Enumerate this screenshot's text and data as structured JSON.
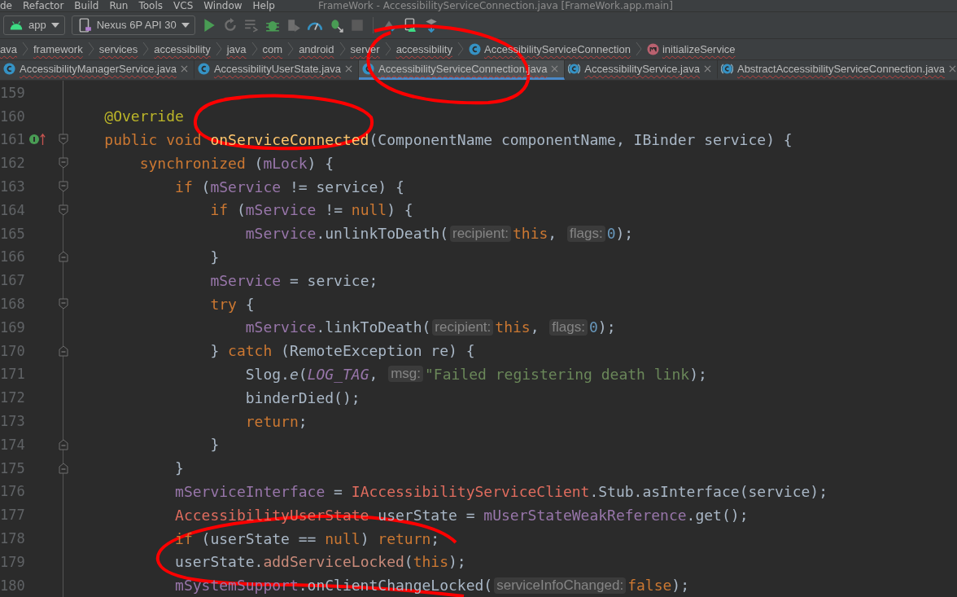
{
  "menu": {
    "items": [
      "de",
      "Refactor",
      "Build",
      "Run",
      "Tools",
      "VCS",
      "Window",
      "Help"
    ],
    "title": "FrameWork - AccessibilityServiceConnection.java [FrameWork.app.main]"
  },
  "toolbar": {
    "config": "app",
    "device": "Nexus 6P API 30"
  },
  "breadcrumbs": [
    {
      "label": "ava",
      "kind": "folder"
    },
    {
      "label": "framework",
      "kind": "folder"
    },
    {
      "label": "services",
      "kind": "folder"
    },
    {
      "label": "accessibility",
      "kind": "folder"
    },
    {
      "label": "java",
      "kind": "folder"
    },
    {
      "label": "com",
      "kind": "folder"
    },
    {
      "label": "android",
      "kind": "folder"
    },
    {
      "label": "server",
      "kind": "folder"
    },
    {
      "label": "accessibility",
      "kind": "folder"
    },
    {
      "label": "AccessibilityServiceConnection",
      "kind": "class"
    },
    {
      "label": "initializeService",
      "kind": "method"
    }
  ],
  "tabs": [
    {
      "label": "AccessibilityManagerService.java",
      "kind": "class",
      "selected": false
    },
    {
      "label": "AccessibilityUserState.java",
      "kind": "class",
      "selected": false
    },
    {
      "label": "AccessibilityServiceConnection.java",
      "kind": "class",
      "selected": true
    },
    {
      "label": "AccessibilityService.java",
      "kind": "abstract",
      "selected": false
    },
    {
      "label": "AbstractAccessibilityServiceConnection.java",
      "kind": "abstract",
      "selected": false
    }
  ],
  "code": [
    {
      "number": "159",
      "kind": "plain",
      "implements": false
    },
    {
      "number": "160",
      "kind": "plain",
      "implements": false,
      "tokens": [
        {
          "text": "    @Override",
          "kind": "annotation"
        }
      ]
    },
    {
      "number": "161",
      "kind": "fold-start",
      "implements": true,
      "tokens": [
        {
          "text": "    public void ",
          "kind": "keyword"
        },
        {
          "text": "onServiceConnected",
          "kind": "declaration"
        },
        {
          "text": "(ComponentName componentName, IBinder service) {",
          "kind": "plain"
        }
      ]
    },
    {
      "number": "162",
      "kind": "fold-start",
      "implements": false,
      "tokens": [
        {
          "text": "        synchronized ",
          "kind": "keyword"
        },
        {
          "text": "(",
          "kind": "plain"
        },
        {
          "text": "mLock",
          "kind": "field"
        },
        {
          "text": ") {",
          "kind": "plain"
        }
      ]
    },
    {
      "number": "163",
      "kind": "fold-start",
      "implements": false,
      "tokens": [
        {
          "text": "            if ",
          "kind": "keyword"
        },
        {
          "text": "(",
          "kind": "plain"
        },
        {
          "text": "mService",
          "kind": "field"
        },
        {
          "text": " != service) {",
          "kind": "plain"
        }
      ]
    },
    {
      "number": "164",
      "kind": "fold-start",
      "implements": false,
      "tokens": [
        {
          "text": "                if ",
          "kind": "keyword"
        },
        {
          "text": "(",
          "kind": "plain"
        },
        {
          "text": "mService",
          "kind": "field"
        },
        {
          "text": " != ",
          "kind": "plain"
        },
        {
          "text": "null",
          "kind": "keyword"
        },
        {
          "text": ") {",
          "kind": "plain"
        }
      ]
    },
    {
      "number": "165",
      "kind": "plain",
      "implements": false,
      "tokens": [
        {
          "text": "                    mService",
          "kind": "field"
        },
        {
          "text": ".unlinkToDeath(",
          "kind": "plain"
        },
        {
          "text": "recipient:",
          "kind": "hint"
        },
        {
          "text": "this",
          "kind": "keyword"
        },
        {
          "text": ", ",
          "kind": "plain"
        },
        {
          "text": "flags:",
          "kind": "hint"
        },
        {
          "text": "0",
          "kind": "number"
        },
        {
          "text": ");",
          "kind": "plain"
        }
      ]
    },
    {
      "number": "166",
      "kind": "fold-end",
      "implements": false,
      "tokens": [
        {
          "text": "                }",
          "kind": "plain"
        }
      ]
    },
    {
      "number": "167",
      "kind": "plain",
      "implements": false,
      "tokens": [
        {
          "text": "                mService",
          "kind": "field"
        },
        {
          "text": " = service;",
          "kind": "plain"
        }
      ]
    },
    {
      "number": "168",
      "kind": "fold-start",
      "implements": false,
      "tokens": [
        {
          "text": "                try",
          "kind": "keyword"
        },
        {
          "text": " {",
          "kind": "plain"
        }
      ]
    },
    {
      "number": "169",
      "kind": "plain",
      "implements": false,
      "tokens": [
        {
          "text": "                    mService",
          "kind": "field"
        },
        {
          "text": ".linkToDeath(",
          "kind": "plain"
        },
        {
          "text": "recipient:",
          "kind": "hint"
        },
        {
          "text": "this",
          "kind": "keyword"
        },
        {
          "text": ", ",
          "kind": "plain"
        },
        {
          "text": "flags:",
          "kind": "hint"
        },
        {
          "text": "0",
          "kind": "number"
        },
        {
          "text": ");",
          "kind": "plain"
        }
      ]
    },
    {
      "number": "170",
      "kind": "fold-end",
      "implements": false,
      "tokens": [
        {
          "text": "                } ",
          "kind": "plain"
        },
        {
          "text": "catch",
          "kind": "keyword"
        },
        {
          "text": " (RemoteException re) {",
          "kind": "plain"
        }
      ]
    },
    {
      "number": "171",
      "kind": "plain",
      "implements": false,
      "tokens": [
        {
          "text": "                    Slog.",
          "kind": "plain"
        },
        {
          "text": "e",
          "kind": "static"
        },
        {
          "text": "(",
          "kind": "plain"
        },
        {
          "text": "LOG_TAG",
          "kind": "constant"
        },
        {
          "text": ", ",
          "kind": "plain"
        },
        {
          "text": "msg:",
          "kind": "hint"
        },
        {
          "text": "\"Failed registering death link",
          "kind": "string"
        },
        {
          "text": ");",
          "kind": "plain"
        }
      ]
    },
    {
      "number": "172",
      "kind": "plain",
      "implements": false,
      "tokens": [
        {
          "text": "                    binderDied();",
          "kind": "plain"
        }
      ]
    },
    {
      "number": "173",
      "kind": "plain",
      "implements": false,
      "tokens": [
        {
          "text": "                    return",
          "kind": "keyword"
        },
        {
          "text": ";",
          "kind": "plain"
        }
      ]
    },
    {
      "number": "174",
      "kind": "fold-end",
      "implements": false,
      "tokens": [
        {
          "text": "                }",
          "kind": "plain"
        }
      ]
    },
    {
      "number": "175",
      "kind": "fold-end",
      "implements": false,
      "tokens": [
        {
          "text": "            }",
          "kind": "plain"
        }
      ]
    },
    {
      "number": "176",
      "kind": "plain",
      "implements": false,
      "tokens": [
        {
          "text": "            mServiceInterface",
          "kind": "field"
        },
        {
          "text": " = ",
          "kind": "plain"
        },
        {
          "text": "IAccessibilityServiceClient",
          "kind": "error"
        },
        {
          "text": ".Stub.asInterface(service);",
          "kind": "plain"
        }
      ]
    },
    {
      "number": "177",
      "kind": "plain",
      "implements": false,
      "tokens": [
        {
          "text": "            AccessibilityUserState",
          "kind": "error"
        },
        {
          "text": " userState = ",
          "kind": "plain"
        },
        {
          "text": "mUserStateWeakReference",
          "kind": "field"
        },
        {
          "text": ".get();",
          "kind": "plain"
        }
      ]
    },
    {
      "number": "178",
      "kind": "plain",
      "implements": false,
      "tokens": [
        {
          "text": "            if",
          "kind": "keyword"
        },
        {
          "text": " (userState == ",
          "kind": "plain"
        },
        {
          "text": "null",
          "kind": "keyword"
        },
        {
          "text": ") ",
          "kind": "plain"
        },
        {
          "text": "return",
          "kind": "keyword"
        },
        {
          "text": ";",
          "kind": "plain"
        }
      ]
    },
    {
      "number": "179",
      "kind": "plain",
      "implements": false,
      "tokens": [
        {
          "text": "            userState.",
          "kind": "plain"
        },
        {
          "text": "addServiceLocked",
          "kind": "call"
        },
        {
          "text": "(",
          "kind": "plain"
        },
        {
          "text": "this",
          "kind": "keyword"
        },
        {
          "text": ");",
          "kind": "plain"
        }
      ]
    },
    {
      "number": "180",
      "kind": "plain",
      "implements": false,
      "tokens": [
        {
          "text": "            mSystemSupport",
          "kind": "field"
        },
        {
          "text": ".onClientChangeLocked(",
          "kind": "plain"
        },
        {
          "text": "serviceInfoChanged:",
          "kind": "hint"
        },
        {
          "text": "false",
          "kind": "keyword"
        },
        {
          "text": ");",
          "kind": "plain"
        }
      ]
    }
  ]
}
